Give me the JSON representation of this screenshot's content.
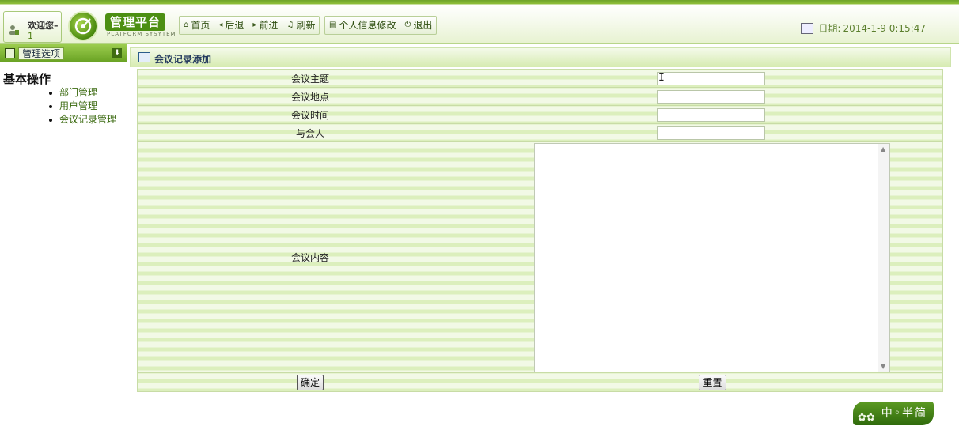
{
  "header": {
    "welcome_text": "欢迎您–",
    "welcome_user": "1",
    "logo_title": "管理平台",
    "logo_subtitle": "PLATFORM SYSYTEM",
    "nav": [
      {
        "label": "首页",
        "icon": "home-icon"
      },
      {
        "label": "后退",
        "icon": "back-icon"
      },
      {
        "label": "前进",
        "icon": "forward-icon"
      },
      {
        "label": "刷新",
        "icon": "refresh-icon"
      }
    ],
    "nav2": [
      {
        "label": "个人信息修改",
        "icon": "profile-icon"
      },
      {
        "label": "退出",
        "icon": "power-icon"
      }
    ],
    "date_label": "日期:",
    "date_value": "2014-1-9 0:15:47"
  },
  "sidebar": {
    "title": "管理选项",
    "heading": "基本操作",
    "items": [
      {
        "label": "部门管理"
      },
      {
        "label": "用户管理"
      },
      {
        "label": "会议记录管理"
      }
    ]
  },
  "main": {
    "panel_title": "会议记录添加",
    "fields": {
      "subject_label": "会议主题",
      "location_label": "会议地点",
      "time_label": "会议时间",
      "participants_label": "与会人",
      "content_label": "会议内容"
    },
    "values": {
      "subject": "",
      "location": "",
      "time": "",
      "participants": "",
      "content": ""
    },
    "buttons": {
      "confirm": "确定",
      "reset": "重置"
    }
  },
  "badge": {
    "text": "中◦半简",
    "flowers": "✿✿"
  },
  "colors": {
    "accent": "#6aa324",
    "link": "#3b6a10",
    "date": "#5b7f2d"
  }
}
